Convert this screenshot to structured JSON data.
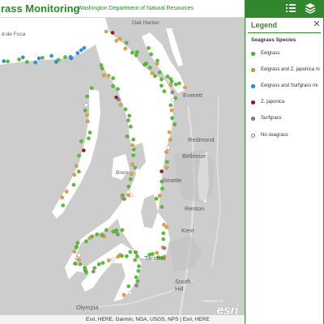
{
  "header": {
    "title": "grass Monitoring",
    "subtitle": "Washington Department of Natural Resources",
    "toolbar": [
      {
        "name": "legend-list-icon"
      },
      {
        "name": "layers-icon"
      }
    ]
  },
  "legend": {
    "title": "Legend",
    "heading": "Seagrass Species",
    "items": [
      {
        "label": "Eelgrass",
        "color": "#58c034"
      },
      {
        "label": "Eelgrass and Z. japonica m",
        "color": "#e3a43a"
      },
      {
        "label": "Eelgrass and Surfgrass mi",
        "color": "#2896de"
      },
      {
        "label": "Z. japonica",
        "color": "#9b1c1c"
      },
      {
        "label": "Surfgrass",
        "color": "#8a8a8a"
      },
      {
        "label": "No seagrass",
        "color": "#ffffff"
      }
    ]
  },
  "map": {
    "places": [
      {
        "label": "Oak Harbor"
      },
      {
        "label": "Everett"
      },
      {
        "label": "Redmond"
      },
      {
        "label": "Bellevue"
      },
      {
        "label": "Seattle"
      },
      {
        "label": "Renton"
      },
      {
        "label": "Kent"
      },
      {
        "label": "Tacoma"
      },
      {
        "label": "South Hill"
      },
      {
        "label": "Olympia"
      },
      {
        "label": "d-de Fuca"
      },
      {
        "label": "Brem"
      }
    ],
    "attribution": "Esri, HERE, Garmin, NGA, USGS, NPS | Esri, HERE",
    "logo": "esri",
    "logo_small": "POWERED BY"
  }
}
